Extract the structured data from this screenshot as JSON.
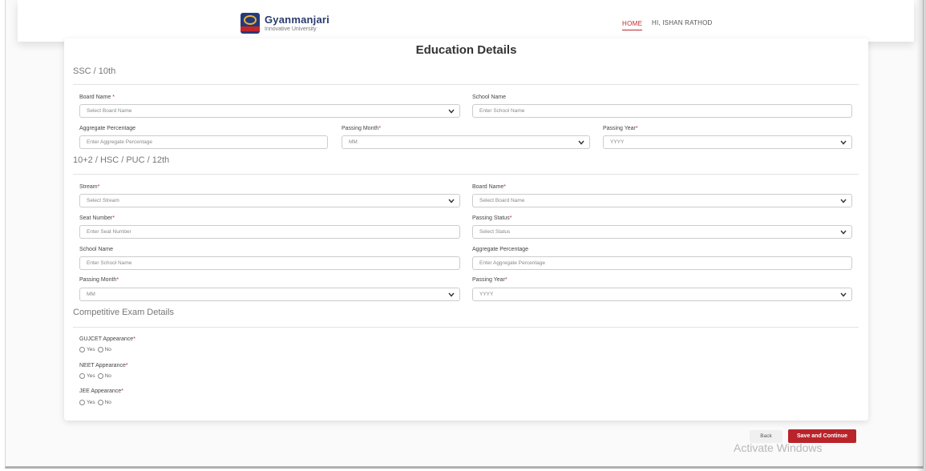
{
  "header": {
    "logo_name": "Gyanmanjari",
    "logo_sub": "Innovative University",
    "nav_home": "HOME",
    "nav_user": "HI, ISHAN RATHOD"
  },
  "page": {
    "title": "Education Details"
  },
  "ssc": {
    "title": "SSC / 10th",
    "board_label": "Board Name",
    "board_placeholder": "Select Board Name",
    "school_label": "School Name",
    "school_placeholder": "Enter School Name",
    "aggregate_label": "Aggregate Percentage",
    "aggregate_placeholder": "Enter Aggregate Percentage",
    "month_label": "Passing Month",
    "month_value": "MM",
    "year_label": "Passing Year",
    "year_value": "YYYY"
  },
  "hsc": {
    "title": "10+2 / HSC / PUC / 12th",
    "stream_label": "Stream",
    "stream_placeholder": "Select Stream",
    "board_label": "Board Name",
    "board_placeholder": "Select Board Name",
    "seat_label": "Seat Number",
    "seat_placeholder": "Enter Seat Number",
    "status_label": "Passing Status",
    "status_placeholder": "Select Status",
    "school_label": "School Name",
    "school_placeholder": "Enter School Name",
    "aggregate_label": "Aggregate Percentage",
    "aggregate_placeholder": "Enter Aggregate Percentage",
    "month_label": "Passing Month",
    "month_value": "MM",
    "year_label": "Passing Year",
    "year_value": "YYYY"
  },
  "exam": {
    "title": "Competitive Exam Details",
    "gujcet_label": "GUJCET Appearance",
    "neet_label": "NEET Appearance",
    "jee_label": "JEE Appearance",
    "yes": "Yes",
    "no": "No"
  },
  "required_mark": "*",
  "buttons": {
    "back": "Back",
    "save": "Save and Continue"
  },
  "watermark": "Activate Windows",
  "colors": {
    "accent": "#c0272d",
    "button": "#b9242b"
  }
}
